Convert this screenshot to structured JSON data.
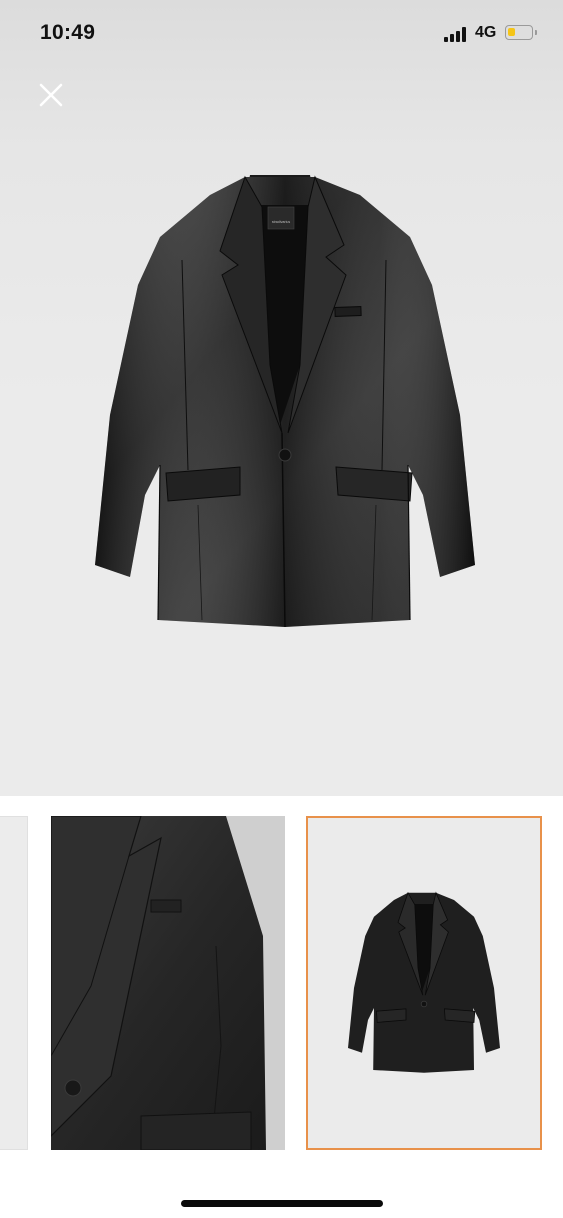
{
  "status_bar": {
    "time": "10:49",
    "network": "4G",
    "battery_level": 0.3,
    "battery_color": "#f5c518",
    "signal_icon": "cellular-signal-icon"
  },
  "viewer": {
    "close_icon": "close-icon",
    "main_image": "black-leather-blazer-front",
    "label_text": "stradivarius",
    "accent_color": "#e8914a"
  },
  "thumbnails": [
    {
      "image": "blank-background-partial",
      "selected": false
    },
    {
      "image": "black-leather-blazer-lapel-detail",
      "selected": false
    },
    {
      "image": "black-leather-blazer-front",
      "selected": true
    }
  ]
}
